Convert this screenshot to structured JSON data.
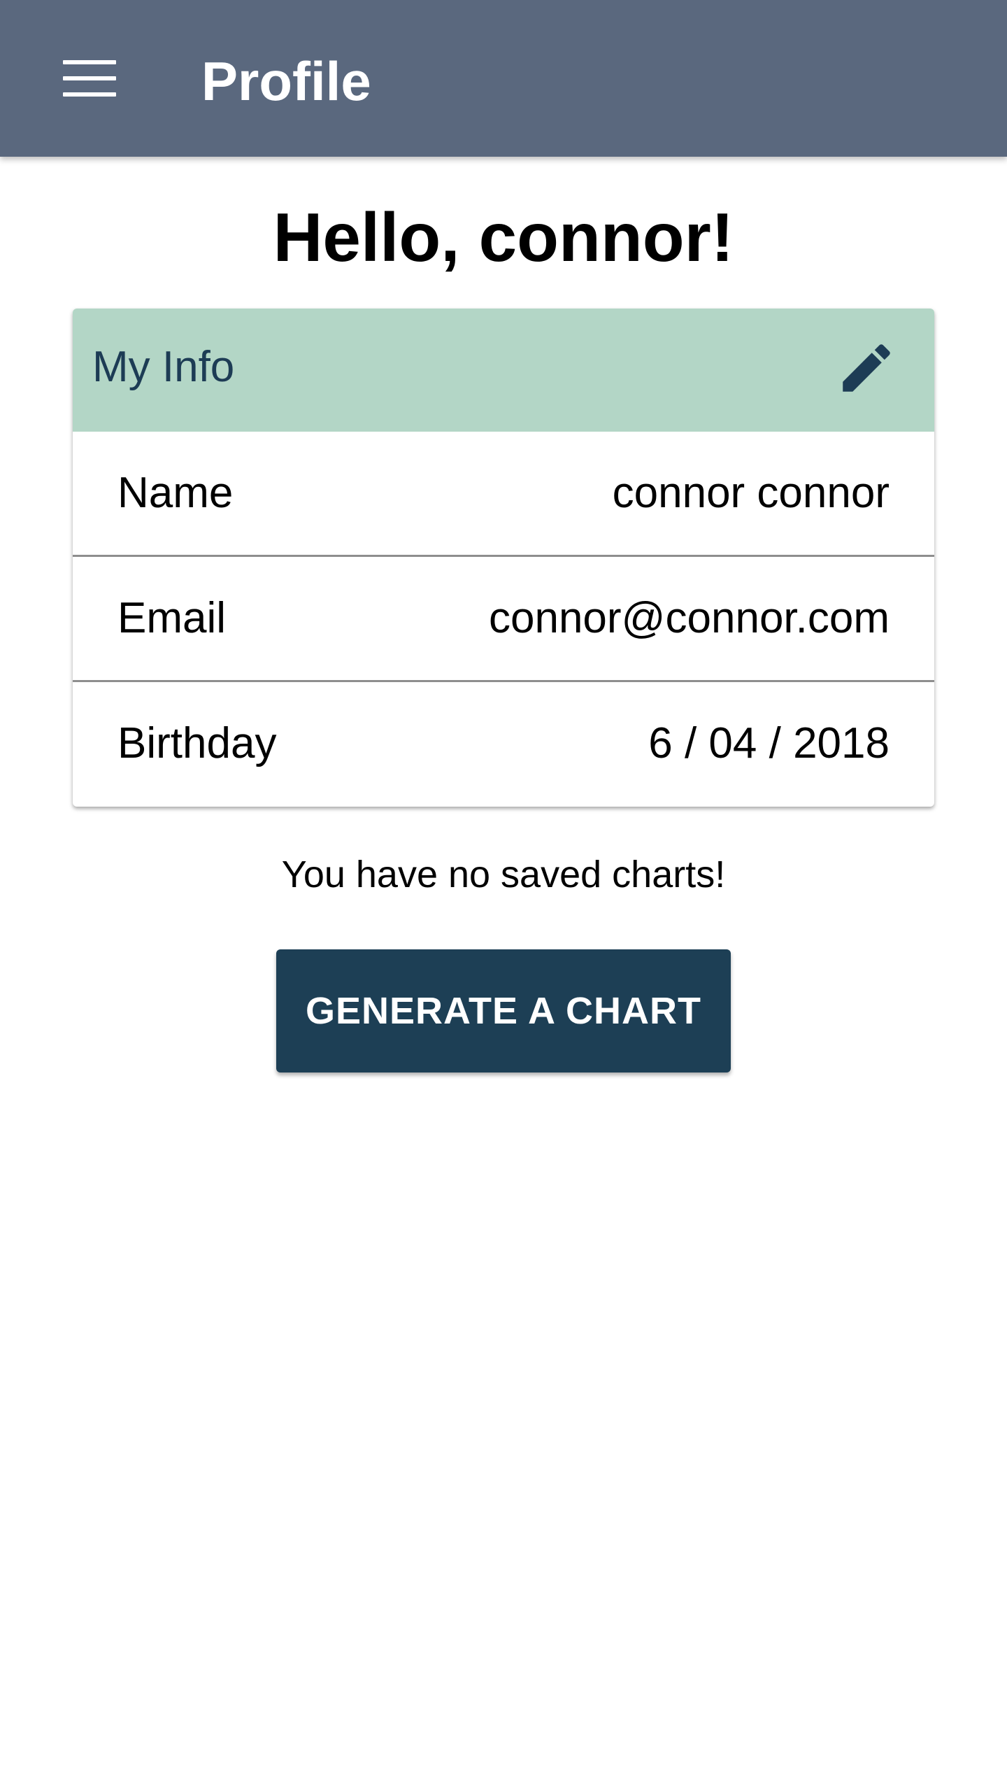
{
  "app_bar": {
    "title": "Profile",
    "menu_icon": "menu-icon",
    "background_color": "#5a687e"
  },
  "greeting": "Hello, connor!",
  "info_card": {
    "title": "My Info",
    "edit_icon": "pencil-icon",
    "header_color": "#b3d6c6",
    "rows": [
      {
        "label": "Name",
        "value": "connor connor"
      },
      {
        "label": "Email",
        "value": "connor@connor.com"
      },
      {
        "label": "Birthday",
        "value": "6 / 04 / 2018"
      }
    ]
  },
  "empty_message": "You have no saved charts!",
  "generate_button": {
    "label": "GENERATE A CHART",
    "color": "#1d3f55"
  }
}
